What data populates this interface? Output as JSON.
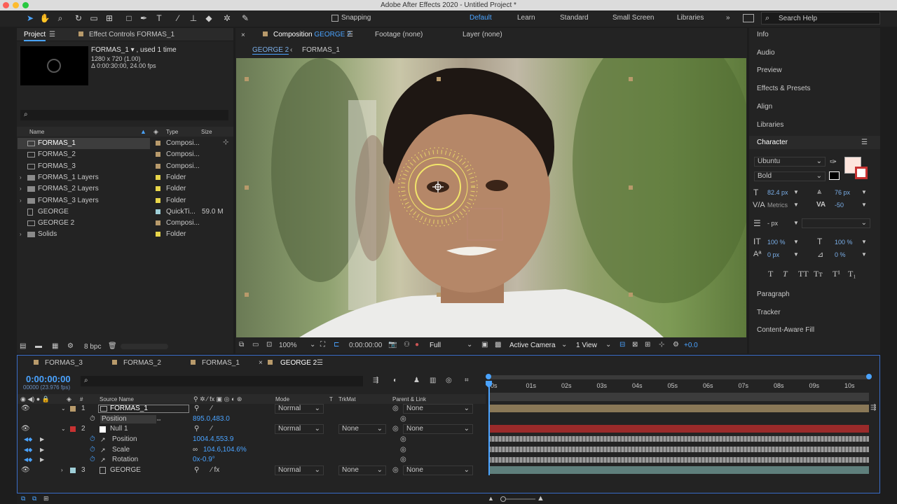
{
  "title": "Adobe After Effects 2020 - Untitled Project *",
  "toolbar": {
    "snapping": "Snapping",
    "workspaces": [
      "Default",
      "Learn",
      "Standard",
      "Small Screen",
      "Libraries"
    ],
    "search": "Search Help"
  },
  "project": {
    "tab": "Project",
    "effect_tab": "Effect Controls FORMAS_1",
    "sel_name": "FORMAS_1 ▾ , used 1 time",
    "sel_res": "1280 x 720 (1.00)",
    "sel_dur": "Δ 0:00:30:00, 24.00 fps",
    "headers": {
      "name": "Name",
      "type": "Type",
      "size": "Size"
    },
    "items": [
      {
        "name": "FORMAS_1",
        "type": "Composi...",
        "size": "",
        "color": "#b89a6b",
        "kind": "comp",
        "sel": true
      },
      {
        "name": "FORMAS_2",
        "type": "Composi...",
        "size": "",
        "color": "#b89a6b",
        "kind": "comp"
      },
      {
        "name": "FORMAS_3",
        "type": "Composi...",
        "size": "",
        "color": "#b89a6b",
        "kind": "comp"
      },
      {
        "name": "FORMAS_1 Layers",
        "type": "Folder",
        "size": "",
        "color": "#e8d64a",
        "kind": "folder"
      },
      {
        "name": "FORMAS_2 Layers",
        "type": "Folder",
        "size": "",
        "color": "#e8d64a",
        "kind": "folder"
      },
      {
        "name": "FORMAS_3 Layers",
        "type": "Folder",
        "size": "",
        "color": "#e8d64a",
        "kind": "folder"
      },
      {
        "name": "GEORGE",
        "type": "QuickTi...",
        "size": "59.0 M",
        "color": "#9fcfd8",
        "kind": "file"
      },
      {
        "name": "GEORGE 2",
        "type": "Composi...",
        "size": "",
        "color": "#b89a6b",
        "kind": "comp"
      },
      {
        "name": "Solids",
        "type": "Folder",
        "size": "",
        "color": "#e8d64a",
        "kind": "folder"
      }
    ],
    "bpc": "8 bpc"
  },
  "viewer": {
    "comp_tab": "Composition",
    "comp_name": "GEORGE 2",
    "footage": "Footage (none)",
    "layer": "Layer (none)",
    "crumb1": "GEORGE 2",
    "crumb2": "FORMAS_1",
    "zoom": "100%",
    "time": "0:00:00:00",
    "res": "Full",
    "camera": "Active Camera",
    "views": "1 View",
    "exposure": "+0.0"
  },
  "right": {
    "items_top": [
      "Info",
      "Audio",
      "Preview",
      "Effects & Presets",
      "Align",
      "Libraries"
    ],
    "character": "Character",
    "font": "Ubuntu",
    "style": "Bold",
    "size": "82.4 px",
    "leading": "76 px",
    "kerning": "Metrics",
    "tracking": "-50",
    "stroke": "- px",
    "vscale": "100 %",
    "hscale": "100 %",
    "baseline": "0 px",
    "tsume": "0 %",
    "type_buttons": [
      "T",
      "T",
      "TT",
      "Tт",
      "T¹",
      "T₁"
    ],
    "items_bottom": [
      "Paragraph",
      "Tracker",
      "Content-Aware Fill"
    ]
  },
  "timeline": {
    "tabs": [
      "FORMAS_3",
      "FORMAS_2",
      "FORMAS_1",
      "GEORGE 2"
    ],
    "time": "0:00:00:00",
    "fps": "00000 (23.976 fps)",
    "headers": {
      "source": "Source Name",
      "mode": "Mode",
      "t": "T",
      "trkmat": "TrkMat",
      "parent": "Parent & Link"
    },
    "ticks": [
      "0s",
      "01s",
      "02s",
      "03s",
      "04s",
      "05s",
      "06s",
      "07s",
      "08s",
      "09s",
      "10s"
    ],
    "layer1": {
      "num": "1",
      "name": "FORMAS_1",
      "mode": "Normal",
      "parent": "None"
    },
    "layer1_prop": {
      "name": "Position",
      "value": "895.0,483.0"
    },
    "layer2": {
      "num": "2",
      "name": "Null 1",
      "mode": "Normal",
      "trkmat": "None",
      "parent": "None"
    },
    "layer2_props": [
      {
        "name": "Position",
        "value": "1004.4,553.9"
      },
      {
        "name": "Scale",
        "value": "104.6,104.6%"
      },
      {
        "name": "Rotation",
        "value": "0x-0.9°"
      }
    ],
    "layer3": {
      "num": "3",
      "name": "GEORGE",
      "mode": "Normal",
      "trkmat": "None",
      "parent": "None"
    }
  }
}
